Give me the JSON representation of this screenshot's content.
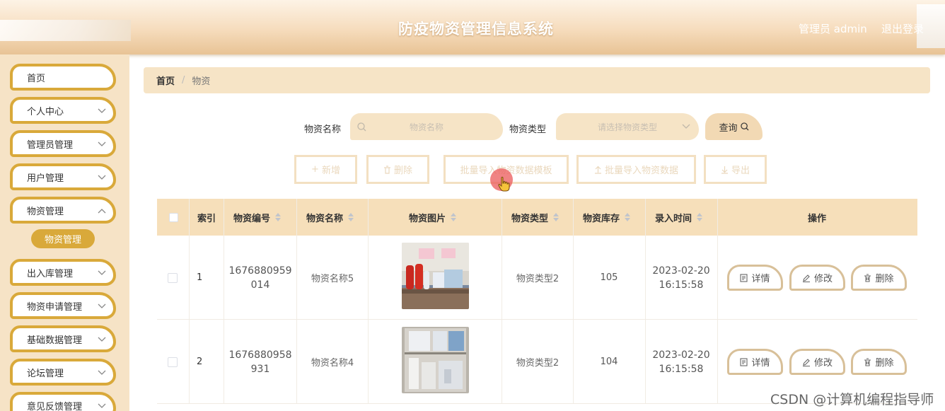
{
  "header": {
    "title": "防疫物资管理信息系统",
    "user": "管理员 admin",
    "logout": "退出登录"
  },
  "sidebar": {
    "items": [
      {
        "label": "首页",
        "has_children": false
      },
      {
        "label": "个人中心",
        "has_children": true
      },
      {
        "label": "管理员管理",
        "has_children": true
      },
      {
        "label": "用户管理",
        "has_children": true
      },
      {
        "label": "物资管理",
        "has_children": true
      },
      {
        "label": "出入库管理",
        "has_children": true
      },
      {
        "label": "物资申请管理",
        "has_children": true
      },
      {
        "label": "基础数据管理",
        "has_children": true
      },
      {
        "label": "论坛管理",
        "has_children": true
      },
      {
        "label": "意见反馈管理",
        "has_children": true
      }
    ],
    "active_sub": "物资管理"
  },
  "breadcrumb": {
    "home": "首页",
    "separator": "/",
    "current": "物资"
  },
  "search": {
    "name_label": "物资名称",
    "name_placeholder": "物资名称",
    "type_label": "物资类型",
    "type_placeholder": "请选择物资类型",
    "query_button": "查询"
  },
  "actions": {
    "add": "新增",
    "delete": "删除",
    "template": "批量导入物资数据模板",
    "import": "批量导入物资数据",
    "export": "导出"
  },
  "table": {
    "headers": [
      "索引",
      "物资编号",
      "物资名称",
      "物资图片",
      "物资类型",
      "物资库存",
      "录入时间",
      "操作"
    ],
    "rows": [
      {
        "index": "1",
        "code_line1": "1676880959",
        "code_line2": "014",
        "name": "物资名称5",
        "type": "物资类型2",
        "stock": "105",
        "date": "2023-02-20",
        "time": "16:15:58"
      },
      {
        "index": "2",
        "code_line1": "1676880958",
        "code_line2": "931",
        "name": "物资名称4",
        "type": "物资类型2",
        "stock": "104",
        "date": "2023-02-20",
        "time": "16:15:58"
      }
    ],
    "ops": {
      "detail": "详情",
      "edit": "修改",
      "delete": "删除"
    }
  },
  "watermark": "CSDN @计算机编程指导师",
  "colors": {
    "accent": "#d9a93a",
    "header_bg": "#f6dfba",
    "sidebar_bg": "#f6e3c6"
  }
}
